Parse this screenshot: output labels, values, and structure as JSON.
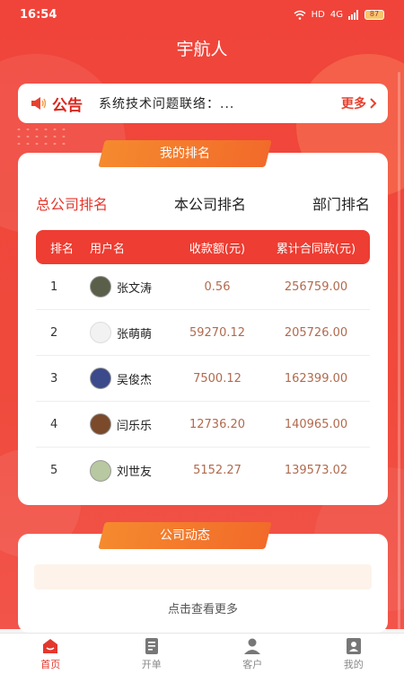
{
  "status_bar": {
    "time": "16:54",
    "network": "HD",
    "signal": "4G",
    "battery": "87"
  },
  "header": {
    "title": "宇航人"
  },
  "notice": {
    "tag": "公告",
    "text": "系统技术问题联络：...",
    "more": "更多"
  },
  "ranking": {
    "section_title": "我的排名",
    "tabs": [
      "总公司排名",
      "本公司排名",
      "部门排名"
    ],
    "active_tab": 0,
    "columns": [
      "排名",
      "用户名",
      "收款额(元)",
      "累计合同款(元)"
    ],
    "rows": [
      {
        "rank": "1",
        "name": "张文涛",
        "amount": "0.56",
        "total": "256759.00"
      },
      {
        "rank": "2",
        "name": "张萌萌",
        "amount": "59270.12",
        "total": "205726.00"
      },
      {
        "rank": "3",
        "name": "吴俊杰",
        "amount": "7500.12",
        "total": "162399.00"
      },
      {
        "rank": "4",
        "name": "闫乐乐",
        "amount": "12736.20",
        "total": "140965.00"
      },
      {
        "rank": "5",
        "name": "刘世友",
        "amount": "5152.27",
        "total": "139573.02"
      }
    ]
  },
  "news": {
    "section_title": "公司动态",
    "more_text": "点击查看更多"
  },
  "bottom_nav": [
    {
      "label": "首页",
      "icon": "home-icon",
      "active": true
    },
    {
      "label": "开单",
      "icon": "order-icon",
      "active": false
    },
    {
      "label": "客户",
      "icon": "customer-icon",
      "active": false
    },
    {
      "label": "我的",
      "icon": "profile-icon",
      "active": false
    }
  ],
  "colors": {
    "primary": "#ee3d32",
    "tag": "#f58a2e",
    "amount_text": "#b16a4e",
    "active_tab": "#e4372d"
  }
}
